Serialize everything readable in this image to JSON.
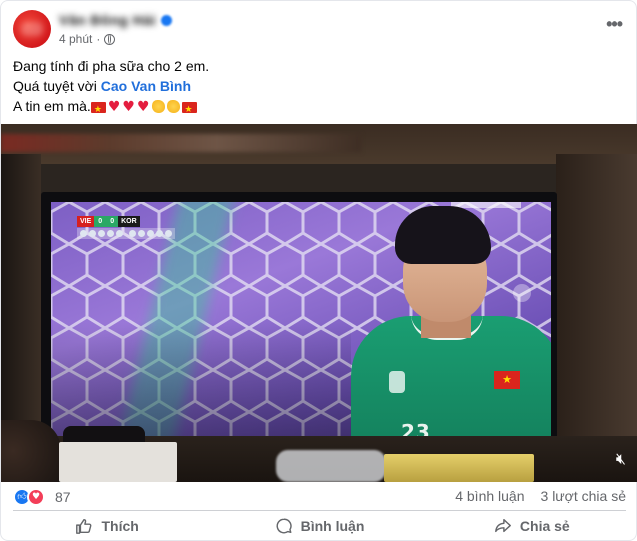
{
  "post": {
    "author_name": "Văn Đông Hải",
    "timestamp": "4 phút",
    "more_icon": "ellipsis-icon",
    "lines": {
      "line1": "Đang tính đi pha sữa cho 2 em.",
      "line2_prefix": "Quá tuyệt vời ",
      "line2_mention": "Cao Van Bình",
      "line3_prefix": "A tin em mà."
    }
  },
  "video": {
    "scorebug": {
      "team_home": "VIE",
      "score_home": "0",
      "score_away": "0",
      "team_away": "KOR"
    },
    "shirt_number": "23",
    "mute_icon": "speaker-muted-icon"
  },
  "engagement": {
    "reaction_count": "87",
    "comments": "4 bình luận",
    "shares": "3 lượt chia sẻ"
  },
  "actions": {
    "like": "Thích",
    "comment": "Bình luận",
    "share": "Chia sẻ"
  },
  "colors": {
    "mention": "#216fdb",
    "like_blue": "#1877f2",
    "love_red": "#f33e58",
    "muted_text": "#65676b"
  }
}
